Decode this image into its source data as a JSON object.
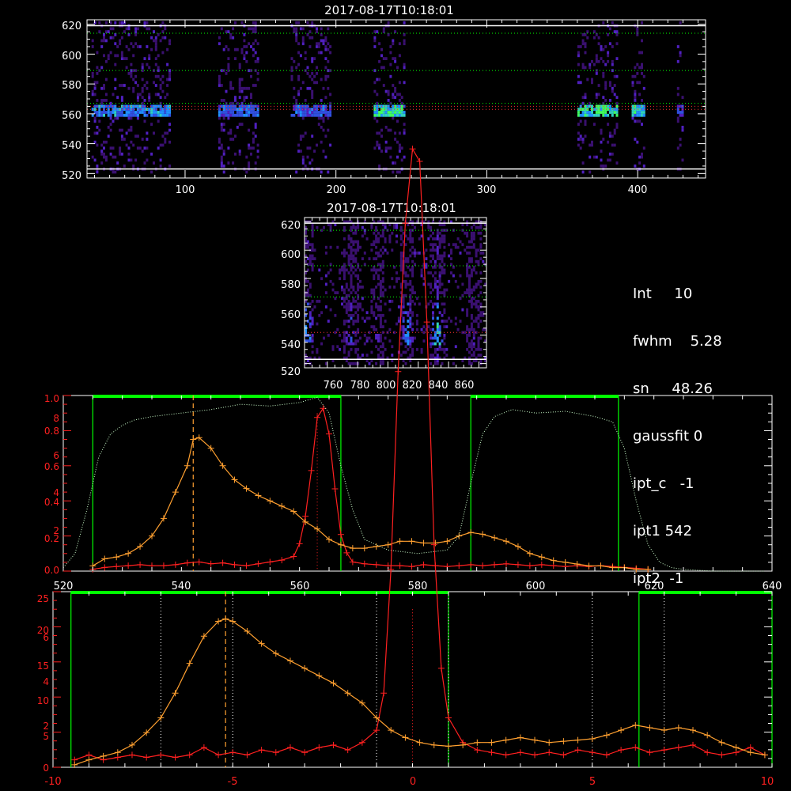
{
  "colors": {
    "axis": "#ffffff",
    "red_curve": "#ff2020",
    "orange_curve": "#ffa030",
    "green_box": "#00ff00",
    "filter_curve": "#ccffcc"
  },
  "image_top": {
    "title": "2017-08-17T10:18:01",
    "x_ticks": [
      "100",
      "200",
      "300",
      "400"
    ],
    "y_ticks": [
      "520",
      "540",
      "560",
      "580",
      "600",
      "620"
    ],
    "xlim": [
      35,
      445
    ],
    "ylim": [
      517,
      623
    ]
  },
  "image_mid": {
    "title": "2017-08-17T10:18:01",
    "x_ticks": [
      "760",
      "780",
      "800",
      "820",
      "840",
      "860"
    ],
    "y_ticks": [
      "520",
      "540",
      "560",
      "580",
      "600",
      "620"
    ],
    "xlim": [
      745,
      865
    ],
    "ylim": [
      517,
      623
    ]
  },
  "info": [
    {
      "key": "Int",
      "value": "10"
    },
    {
      "key": "fwhm",
      "value": "5.28"
    },
    {
      "key": "sn",
      "value": "48.26"
    },
    {
      "key": "gaussfit",
      "value": "0"
    },
    {
      "key": "ipt_c",
      "value": "-1"
    },
    {
      "key": "ipt1",
      "value": "542"
    },
    {
      "key": "ipt2",
      "value": "-1"
    }
  ],
  "chart_data": [
    {
      "type": "line",
      "xlim": [
        520,
        640
      ],
      "x_ticks": [
        "520",
        "540",
        "560",
        "580",
        "600",
        "620",
        "640"
      ],
      "y_ticks_left": [
        "0.0",
        "0.2",
        "0.4",
        "0.6",
        "0.8",
        "1.0"
      ],
      "y_ticks_red": [
        "2",
        "4",
        "6",
        "8"
      ],
      "ylim": [
        0,
        1.0
      ],
      "red_ylim": [
        0,
        9.6
      ],
      "series": [
        {
          "color": "red",
          "x": [
            525,
            527,
            529,
            531,
            533,
            535,
            537,
            539,
            541,
            543,
            545,
            547,
            549,
            551,
            553,
            555,
            557,
            559,
            560,
            561,
            562,
            563,
            564,
            565,
            566,
            567,
            568,
            569,
            571,
            573,
            575,
            577,
            579,
            581,
            583,
            585,
            587,
            589,
            591,
            593,
            595,
            597,
            599,
            601,
            603,
            605,
            607,
            609,
            611,
            613,
            615,
            617,
            619
          ],
          "y": [
            0.1,
            0.2,
            0.25,
            0.3,
            0.35,
            0.3,
            0.3,
            0.35,
            0.45,
            0.5,
            0.4,
            0.45,
            0.35,
            0.3,
            0.4,
            0.5,
            0.6,
            0.8,
            1.5,
            3.0,
            5.5,
            8.4,
            8.9,
            7.5,
            4.5,
            2.0,
            1.0,
            0.5,
            0.4,
            0.35,
            0.3,
            0.3,
            0.25,
            0.35,
            0.3,
            0.25,
            0.3,
            0.35,
            0.3,
            0.35,
            0.4,
            0.35,
            0.3,
            0.35,
            0.3,
            0.25,
            0.3,
            0.25,
            0.3,
            0.25,
            0.2,
            0.15,
            0.1
          ]
        },
        {
          "color": "orange",
          "x": [
            525,
            527,
            529,
            531,
            533,
            535,
            537,
            539,
            541,
            542,
            543,
            545,
            547,
            549,
            551,
            553,
            555,
            557,
            559,
            561,
            563,
            565,
            567,
            569,
            571,
            573,
            575,
            577,
            579,
            581,
            583,
            585,
            587,
            589,
            591,
            593,
            595,
            597,
            599,
            601,
            603,
            605,
            607,
            609,
            611,
            613,
            615,
            617,
            619
          ],
          "y": [
            0.03,
            0.07,
            0.08,
            0.1,
            0.14,
            0.2,
            0.3,
            0.45,
            0.6,
            0.75,
            0.76,
            0.7,
            0.6,
            0.52,
            0.47,
            0.43,
            0.4,
            0.37,
            0.34,
            0.28,
            0.24,
            0.18,
            0.15,
            0.13,
            0.13,
            0.14,
            0.15,
            0.17,
            0.17,
            0.16,
            0.16,
            0.17,
            0.2,
            0.22,
            0.21,
            0.19,
            0.17,
            0.14,
            0.1,
            0.08,
            0.06,
            0.05,
            0.04,
            0.03,
            0.03,
            0.02,
            0.02,
            0.01,
            0.01
          ]
        },
        {
          "color": "filter",
          "x": [
            520,
            522,
            524,
            526,
            528,
            530,
            532,
            535,
            540,
            545,
            550,
            555,
            560,
            563,
            565,
            567,
            569,
            571,
            575,
            580,
            585,
            587,
            589,
            591,
            593,
            596,
            600,
            605,
            610,
            613,
            615,
            617,
            619,
            621,
            623,
            625,
            630,
            635,
            640
          ],
          "y": [
            0.02,
            0.1,
            0.35,
            0.65,
            0.78,
            0.83,
            0.86,
            0.88,
            0.9,
            0.92,
            0.95,
            0.94,
            0.96,
            0.99,
            0.9,
            0.6,
            0.35,
            0.18,
            0.12,
            0.1,
            0.12,
            0.2,
            0.5,
            0.78,
            0.88,
            0.92,
            0.9,
            0.91,
            0.88,
            0.85,
            0.7,
            0.4,
            0.15,
            0.05,
            0.02,
            0.01,
            0.0,
            0.0,
            0.0
          ]
        }
      ],
      "peak_marker_x": 542,
      "center_marker_x": 563,
      "filter_boxes": [
        [
          525,
          567
        ],
        [
          589,
          614
        ]
      ]
    },
    {
      "type": "line",
      "xlim": [
        -10,
        10
      ],
      "x_ticks": [
        "-10",
        "-5",
        "0",
        "5",
        "10"
      ],
      "y_ticks_left": [
        "0",
        "5",
        "10",
        "15",
        "20",
        "25"
      ],
      "y_ticks_red": [
        "2",
        "4",
        "6"
      ],
      "ylim": [
        0,
        25
      ],
      "red_ylim": [
        0,
        7.1
      ],
      "series": [
        {
          "color": "red",
          "x": [
            -9.4,
            -9.0,
            -8.6,
            -8.2,
            -7.8,
            -7.4,
            -7.0,
            -6.6,
            -6.2,
            -5.8,
            -5.4,
            -5.0,
            -4.6,
            -4.2,
            -3.8,
            -3.4,
            -3.0,
            -2.6,
            -2.2,
            -1.8,
            -1.4,
            -1.0,
            -0.8,
            -0.6,
            -0.4,
            -0.2,
            0.0,
            0.2,
            0.4,
            0.6,
            0.8,
            1.0,
            1.4,
            1.8,
            2.2,
            2.6,
            3.0,
            3.4,
            3.8,
            4.2,
            4.6,
            5.0,
            5.4,
            5.8,
            6.2,
            6.6,
            7.0,
            7.4,
            7.8,
            8.2,
            8.6,
            9.0,
            9.4,
            9.8
          ],
          "y": [
            0.3,
            0.5,
            0.3,
            0.4,
            0.5,
            0.4,
            0.5,
            0.4,
            0.5,
            0.8,
            0.5,
            0.6,
            0.5,
            0.7,
            0.6,
            0.8,
            0.6,
            0.8,
            0.9,
            0.7,
            1.0,
            1.5,
            3.0,
            8.0,
            16.0,
            22.0,
            25.0,
            24.5,
            18.0,
            9.0,
            4.0,
            2.0,
            1.0,
            0.7,
            0.6,
            0.5,
            0.6,
            0.5,
            0.6,
            0.5,
            0.7,
            0.6,
            0.5,
            0.7,
            0.8,
            0.6,
            0.7,
            0.8,
            0.9,
            0.6,
            0.5,
            0.6,
            0.8,
            0.5
          ]
        },
        {
          "color": "orange",
          "x": [
            -9.4,
            -9.0,
            -8.6,
            -8.2,
            -7.8,
            -7.4,
            -7.0,
            -6.6,
            -6.2,
            -5.8,
            -5.4,
            -5.2,
            -5.0,
            -4.6,
            -4.2,
            -3.8,
            -3.4,
            -3.0,
            -2.6,
            -2.2,
            -1.8,
            -1.4,
            -1.0,
            -0.6,
            -0.2,
            0.2,
            0.6,
            1.0,
            1.4,
            1.8,
            2.2,
            2.6,
            3.0,
            3.4,
            3.8,
            4.2,
            4.6,
            5.0,
            5.4,
            5.8,
            6.2,
            6.6,
            7.0,
            7.4,
            7.8,
            8.2,
            8.6,
            9.0,
            9.4,
            9.8
          ],
          "y": [
            0.1,
            0.3,
            0.45,
            0.6,
            0.9,
            1.4,
            2.0,
            3.0,
            4.2,
            5.3,
            5.9,
            6.0,
            5.9,
            5.5,
            5.0,
            4.6,
            4.3,
            4.0,
            3.7,
            3.4,
            3.0,
            2.6,
            2.0,
            1.5,
            1.2,
            1.0,
            0.9,
            0.85,
            0.9,
            1.0,
            1.0,
            1.1,
            1.2,
            1.1,
            1.0,
            1.05,
            1.1,
            1.15,
            1.3,
            1.5,
            1.7,
            1.6,
            1.5,
            1.6,
            1.5,
            1.3,
            1.0,
            0.8,
            0.6,
            0.5
          ]
        }
      ],
      "peak_marker_x": -5.2,
      "center_marker_x": 0,
      "dotted_lines_x": [
        -7,
        -5,
        -1,
        1,
        5,
        7
      ],
      "filter_boxes": [
        [
          -9.5,
          1.0
        ],
        [
          6.3,
          10
        ]
      ]
    }
  ]
}
